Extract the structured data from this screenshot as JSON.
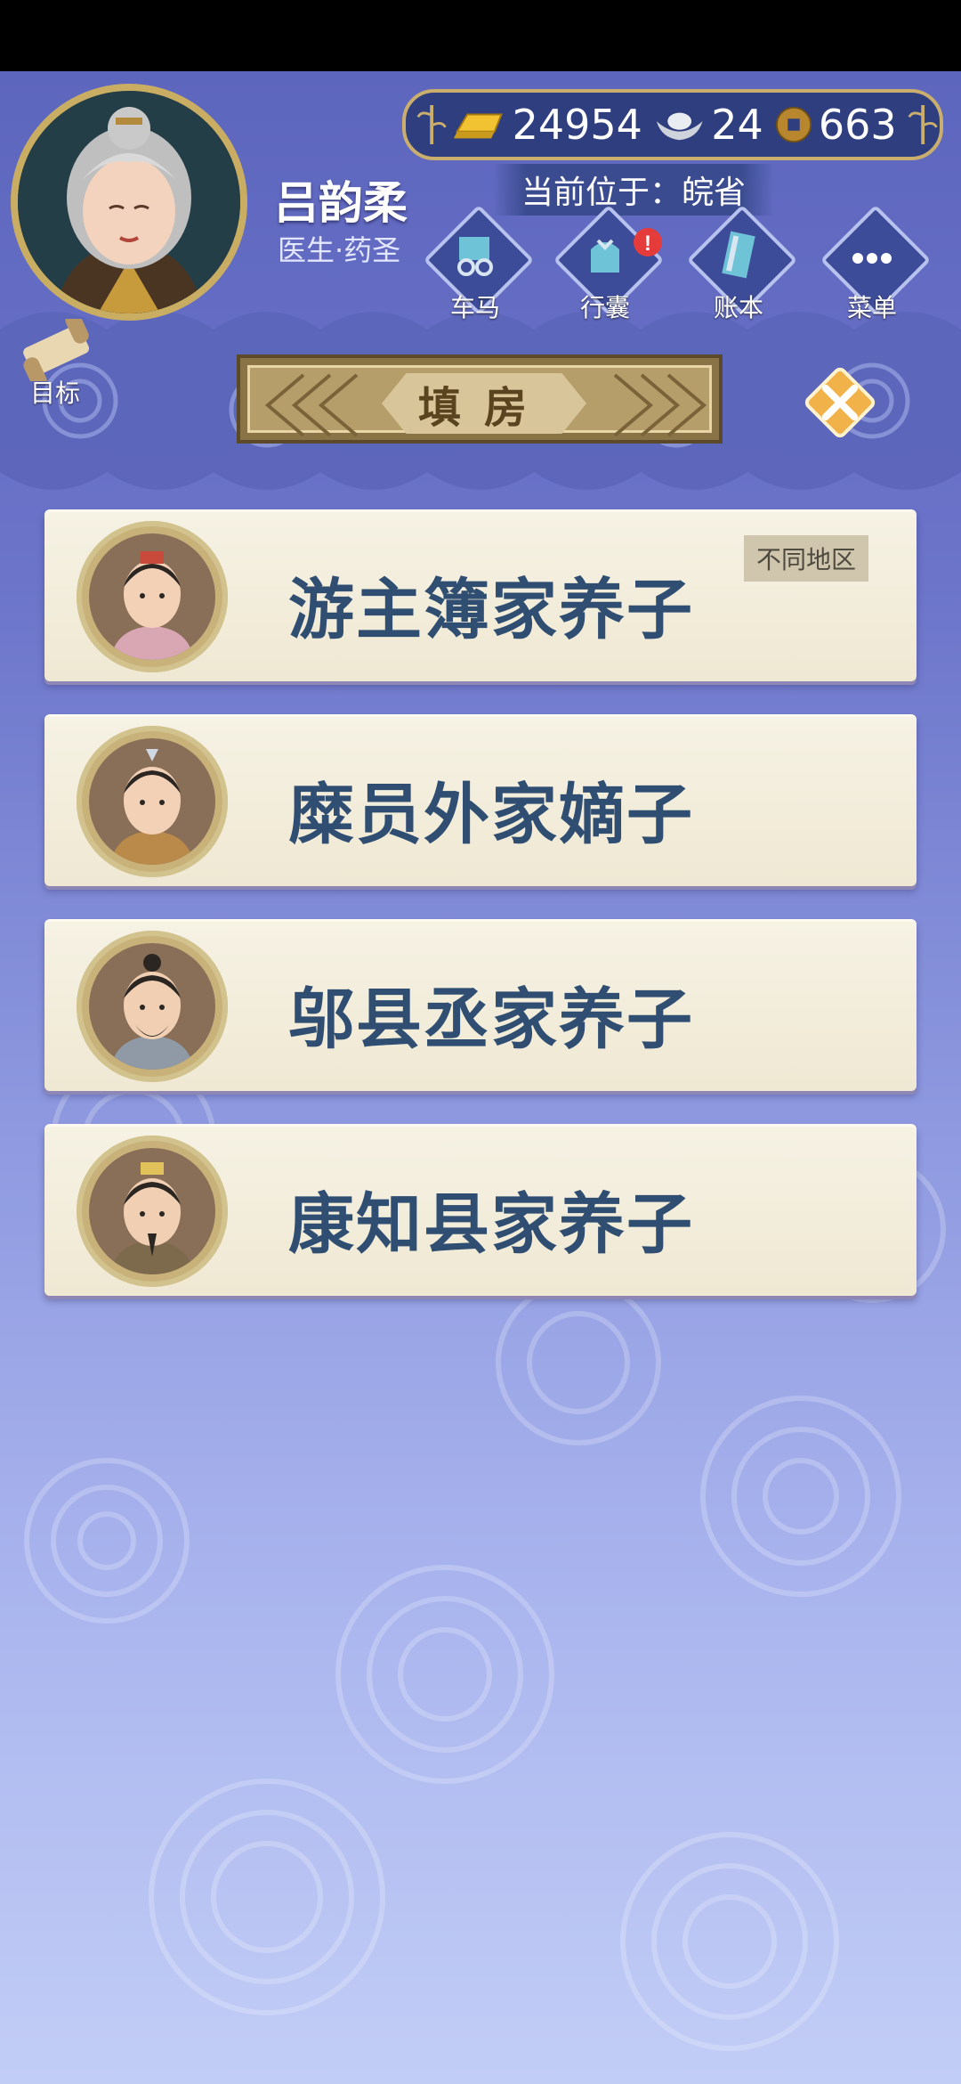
{
  "player": {
    "name": "吕韵柔",
    "title": "医生·药圣"
  },
  "currencies": {
    "gold": "24954",
    "silver": "24",
    "copper": "663"
  },
  "location": "当前位于：皖省",
  "nav": [
    {
      "label": "车马",
      "icon": "carriage-icon"
    },
    {
      "label": "行囊",
      "icon": "bag-icon",
      "alert": "!"
    },
    {
      "label": "账本",
      "icon": "ledger-icon"
    },
    {
      "label": "菜单",
      "icon": "menu-dots-icon"
    }
  ],
  "goal_label": "目标",
  "page_title": "填房",
  "candidates": [
    {
      "name": "游主簿家养子",
      "tag": "不同地区"
    },
    {
      "name": "糜员外家嫡子",
      "tag": ""
    },
    {
      "name": "邬县丞家养子",
      "tag": ""
    },
    {
      "name": "康知县家养子",
      "tag": ""
    }
  ],
  "colors": {
    "name_text": "#2f4e72",
    "gold_frame": "#c9ad63",
    "bg_top": "#5d66bd",
    "bg_bottom": "#c2cdf6"
  }
}
